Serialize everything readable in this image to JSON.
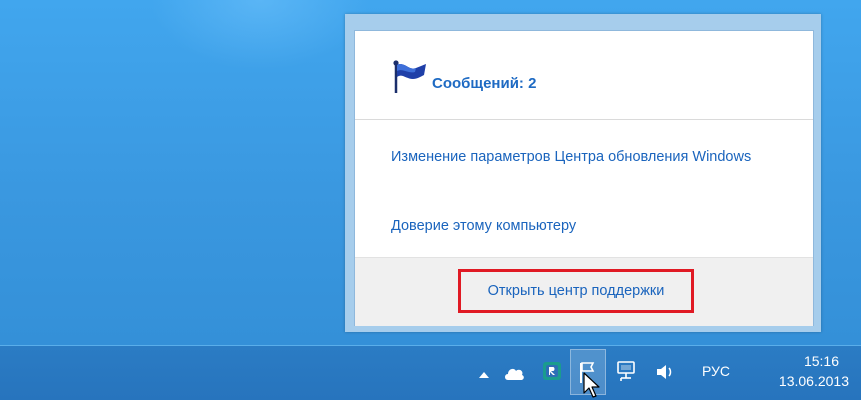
{
  "flyout": {
    "title": "Сообщений: 2",
    "messages": [
      "Изменение параметров Центра обновления Windows",
      "Доверие этому компьютеру"
    ],
    "open_center": "Открыть центр поддержки"
  },
  "taskbar": {
    "language": "РУС",
    "time": "15:16",
    "date": "13.06.2013",
    "tray_icons": [
      "show-hidden-icons",
      "cloud-icon",
      "r-app-icon",
      "action-center-flag-icon",
      "network-icon",
      "volume-icon"
    ]
  },
  "colors": {
    "link": "#1a64bd",
    "highlight_border": "#e01a24",
    "taskbar": "#2774bd",
    "desktop": "#3c9be0"
  }
}
